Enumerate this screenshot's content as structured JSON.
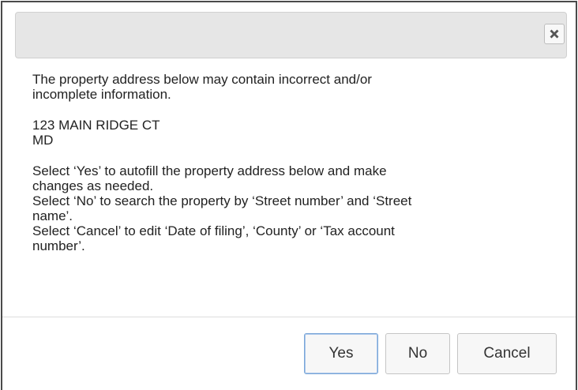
{
  "dialog": {
    "close_icon": "close-icon",
    "message": {
      "intro": [
        "The property address below may contain incorrect and/or",
        "incomplete information."
      ],
      "address": [
        "123 MAIN RIDGE CT",
        "MD"
      ],
      "instructions": [
        "Select ‘Yes’ to autofill the property address below and make",
        "changes as needed.",
        "Select ‘No’ to search the property by ‘Street number’ and ‘Street",
        "name’.",
        "Select ‘Cancel’ to edit ‘Date of filing’, ‘County’ or ‘Tax account",
        "number’."
      ]
    },
    "buttons": {
      "yes_label": "Yes",
      "no_label": "No",
      "cancel_label": "Cancel"
    }
  },
  "colors": {
    "titlebar_bg": "#e6e6e6",
    "button_bg": "#f7f7f7",
    "focus_border": "#7aa6d8"
  }
}
